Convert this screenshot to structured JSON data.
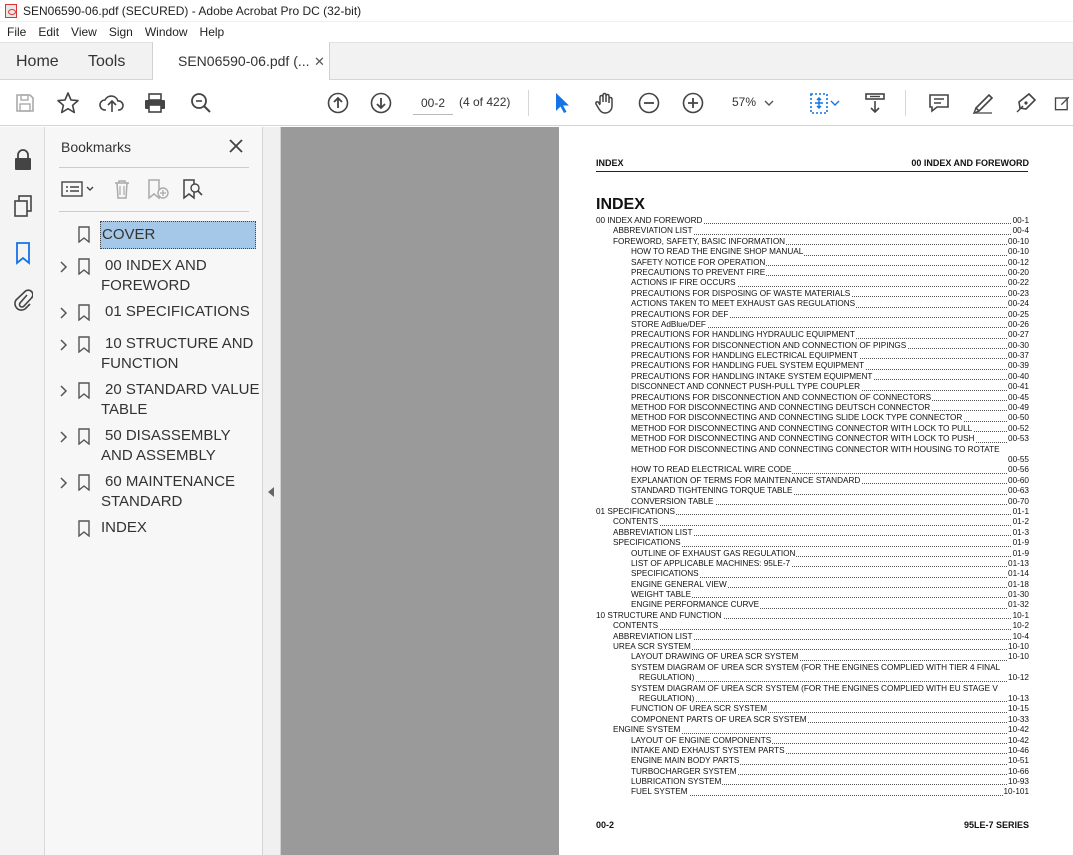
{
  "window": {
    "title": "SEN06590-06.pdf (SECURED) - Adobe Acrobat Pro DC (32-bit)"
  },
  "menu": [
    "File",
    "Edit",
    "View",
    "Sign",
    "Window",
    "Help"
  ],
  "tabs": {
    "home": "Home",
    "tools": "Tools",
    "doc": "SEN06590-06.pdf (...",
    "close": "✕"
  },
  "toolbar": {
    "page_value": "00-2",
    "page_count": "(4 of 422)",
    "zoom": "57%"
  },
  "bookmarks": {
    "title": "Bookmarks",
    "items": [
      {
        "label": "COVER",
        "expandable": false,
        "selected": true
      },
      {
        "label": "00 INDEX AND FOREWORD",
        "expandable": true
      },
      {
        "label": "01 SPECIFICATIONS",
        "expandable": true
      },
      {
        "label": "10 STRUCTURE AND FUNCTION",
        "expandable": true
      },
      {
        "label": "20 STANDARD VALUE TABLE",
        "expandable": true
      },
      {
        "label": "50 DISASSEMBLY AND ASSEMBLY",
        "expandable": true
      },
      {
        "label": "60 MAINTENANCE STANDARD",
        "expandable": true
      },
      {
        "label": "INDEX",
        "expandable": false
      }
    ]
  },
  "document": {
    "header_left": "INDEX",
    "header_right": "00 INDEX AND FOREWORD",
    "heading": "INDEX",
    "footer_left": "00-2",
    "footer_right": "95LE-7 SERIES",
    "toc": [
      {
        "level": 0,
        "text": "00 INDEX AND FOREWORD",
        "page": "00-1"
      },
      {
        "level": 1,
        "text": "ABBREVIATION LIST",
        "page": "00-4"
      },
      {
        "level": 1,
        "text": "FOREWORD, SAFETY, BASIC INFORMATION",
        "page": "00-10"
      },
      {
        "level": 2,
        "text": "HOW TO READ THE ENGINE SHOP MANUAL",
        "page": "00-10"
      },
      {
        "level": 2,
        "text": "SAFETY NOTICE FOR OPERATION",
        "page": "00-12"
      },
      {
        "level": 2,
        "text": "PRECAUTIONS TO PREVENT FIRE",
        "page": "00-20"
      },
      {
        "level": 2,
        "text": "ACTIONS IF FIRE OCCURS",
        "page": "00-22"
      },
      {
        "level": 2,
        "text": "PRECAUTIONS FOR DISPOSING OF WASTE MATERIALS",
        "page": "00-23"
      },
      {
        "level": 2,
        "text": "ACTIONS TAKEN TO MEET EXHAUST GAS REGULATIONS",
        "page": "00-24"
      },
      {
        "level": 2,
        "text": "PRECAUTIONS FOR DEF",
        "page": "00-25"
      },
      {
        "level": 2,
        "text": "STORE AdBlue/DEF",
        "page": "00-26"
      },
      {
        "level": 2,
        "text": "PRECAUTIONS FOR HANDLING HYDRAULIC EQUIPMENT",
        "page": "00-27"
      },
      {
        "level": 2,
        "text": "PRECAUTIONS FOR DISCONNECTION AND CONNECTION OF PIPINGS",
        "page": "00-30"
      },
      {
        "level": 2,
        "text": "PRECAUTIONS FOR HANDLING ELECTRICAL EQUIPMENT",
        "page": "00-37"
      },
      {
        "level": 2,
        "text": "PRECAUTIONS FOR HANDLING FUEL SYSTEM EQUIPMENT",
        "page": "00-39"
      },
      {
        "level": 2,
        "text": "PRECAUTIONS FOR HANDLING INTAKE SYSTEM EQUIPMENT",
        "page": "00-40"
      },
      {
        "level": 2,
        "text": "DISCONNECT AND CONNECT PUSH-PULL TYPE COUPLER",
        "page": "00-41"
      },
      {
        "level": 2,
        "text": "PRECAUTIONS FOR DISCONNECTION AND CONNECTION OF CONNECTORS",
        "page": "00-45"
      },
      {
        "level": 2,
        "text": "METHOD FOR DISCONNECTING AND CONNECTING DEUTSCH CONNECTOR",
        "page": "00-49"
      },
      {
        "level": 2,
        "text": "METHOD FOR DISCONNECTING AND CONNECTING SLIDE LOCK TYPE CONNECTOR",
        "page": "00-50"
      },
      {
        "level": 2,
        "text": "METHOD FOR DISCONNECTING AND CONNECTING CONNECTOR WITH LOCK TO PULL",
        "page": "00-52"
      },
      {
        "level": 2,
        "text": "METHOD FOR DISCONNECTING AND CONNECTING CONNECTOR WITH LOCK TO PUSH",
        "page": "00-53"
      },
      {
        "level": 2,
        "text": "METHOD FOR DISCONNECTING AND CONNECTING CONNECTOR WITH HOUSING TO ROTATE",
        "page": ""
      },
      {
        "level": 2,
        "text": "",
        "page": "00-55"
      },
      {
        "level": 2,
        "text": "HOW TO READ ELECTRICAL WIRE CODE",
        "page": "00-56"
      },
      {
        "level": 2,
        "text": "EXPLANATION OF TERMS FOR MAINTENANCE STANDARD",
        "page": "00-60"
      },
      {
        "level": 2,
        "text": "STANDARD TIGHTENING TORQUE TABLE",
        "page": "00-63"
      },
      {
        "level": 2,
        "text": "CONVERSION TABLE",
        "page": "00-70"
      },
      {
        "level": 0,
        "text": "01 SPECIFICATIONS",
        "page": "01-1"
      },
      {
        "level": 1,
        "text": "CONTENTS",
        "page": "01-2"
      },
      {
        "level": 1,
        "text": "ABBREVIATION LIST",
        "page": "01-3"
      },
      {
        "level": 1,
        "text": "SPECIFICATIONS",
        "page": "01-9"
      },
      {
        "level": 2,
        "text": "OUTLINE OF EXHAUST GAS REGULATION",
        "page": "01-9"
      },
      {
        "level": 2,
        "text": "LIST OF APPLICABLE MACHINES: 95LE-7",
        "page": "01-13"
      },
      {
        "level": 2,
        "text": "SPECIFICATIONS",
        "page": "01-14"
      },
      {
        "level": 2,
        "text": "ENGINE GENERAL VIEW",
        "page": "01-18"
      },
      {
        "level": 2,
        "text": "WEIGHT TABLE",
        "page": "01-30"
      },
      {
        "level": 2,
        "text": "ENGINE PERFORMANCE CURVE",
        "page": "01-32"
      },
      {
        "level": 0,
        "text": "10 STRUCTURE AND FUNCTION",
        "page": "10-1"
      },
      {
        "level": 1,
        "text": "CONTENTS",
        "page": "10-2"
      },
      {
        "level": 1,
        "text": "ABBREVIATION LIST",
        "page": "10-4"
      },
      {
        "level": 1,
        "text": "UREA SCR SYSTEM",
        "page": "10-10"
      },
      {
        "level": 2,
        "text": "LAYOUT DRAWING OF UREA SCR SYSTEM",
        "page": "10-10"
      },
      {
        "level": 2,
        "text": "SYSTEM DIAGRAM OF UREA SCR SYSTEM (FOR THE ENGINES COMPLIED WITH TIER 4 FINAL",
        "page": ""
      },
      {
        "level": 3,
        "text": "REGULATION)",
        "page": "10-12"
      },
      {
        "level": 2,
        "text": "SYSTEM DIAGRAM OF UREA SCR SYSTEM (FOR THE ENGINES COMPLIED WITH EU STAGE V",
        "page": ""
      },
      {
        "level": 3,
        "text": "REGULATION)",
        "page": "10-13"
      },
      {
        "level": 2,
        "text": "FUNCTION OF UREA SCR SYSTEM",
        "page": "10-15"
      },
      {
        "level": 2,
        "text": "COMPONENT PARTS OF UREA SCR SYSTEM",
        "page": "10-33"
      },
      {
        "level": 1,
        "text": "ENGINE SYSTEM",
        "page": "10-42"
      },
      {
        "level": 2,
        "text": "LAYOUT OF ENGINE COMPONENTS",
        "page": "10-42"
      },
      {
        "level": 2,
        "text": "INTAKE AND EXHAUST SYSTEM PARTS",
        "page": "10-46"
      },
      {
        "level": 2,
        "text": "ENGINE MAIN BODY PARTS",
        "page": "10-51"
      },
      {
        "level": 2,
        "text": "TURBOCHARGER SYSTEM",
        "page": "10-66"
      },
      {
        "level": 2,
        "text": "LUBRICATION SYSTEM",
        "page": "10-93"
      },
      {
        "level": 2,
        "text": "FUEL SYSTEM",
        "page": "10-101"
      }
    ]
  }
}
